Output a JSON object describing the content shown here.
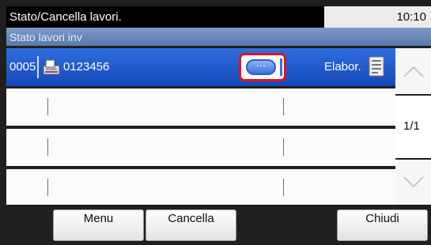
{
  "header": {
    "title": "Stato/Cancella lavori.",
    "time": "10:10"
  },
  "subheader": {
    "title": "Stato lavori inv"
  },
  "job_list": {
    "rows": [
      {
        "number": "0005",
        "destination": "0123456",
        "status": "Elabor.",
        "type_icon": "fax-icon",
        "details_icon": "details-icon"
      },
      {
        "number": "",
        "destination": "",
        "status": ""
      },
      {
        "number": "",
        "destination": "",
        "status": ""
      },
      {
        "number": "",
        "destination": "",
        "status": ""
      }
    ]
  },
  "pagination": {
    "page": "1/1",
    "up_icon": "chevron-up-icon",
    "down_icon": "chevron-down-icon"
  },
  "buttons": {
    "menu": "Menu",
    "cancel": "Cancella",
    "close": "Chiudi"
  },
  "colors": {
    "selected_row": "#1f5bd0",
    "highlight": "#e0141e",
    "title_bar": "#000000",
    "subtitle_bar": "#6a87b8"
  }
}
